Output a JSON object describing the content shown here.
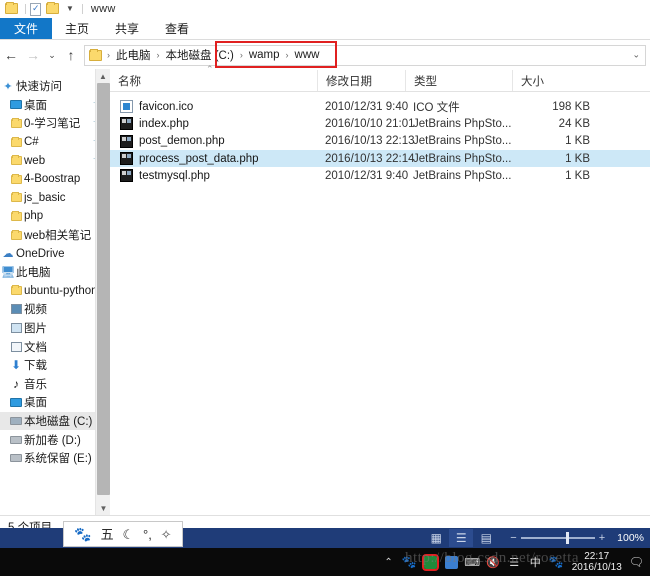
{
  "window": {
    "title": "www",
    "quick_access_icons": [
      "folder-icon",
      "properties-icon",
      "new-folder-icon",
      "customize-chevron-icon"
    ]
  },
  "ribbon": {
    "tabs": [
      {
        "label": "文件",
        "active": true
      },
      {
        "label": "主页",
        "active": false
      },
      {
        "label": "共享",
        "active": false
      },
      {
        "label": "查看",
        "active": false
      }
    ]
  },
  "addressbar": {
    "back_icon": "back-arrow-icon",
    "forward_icon": "forward-arrow-icon",
    "recent_icon": "recent-locations-icon",
    "up_icon": "up-arrow-icon",
    "dropdown_icon": "chevron-down-icon",
    "crumbs": [
      "此电脑",
      "本地磁盘 (C:)",
      "wamp",
      "www"
    ],
    "separator": "›"
  },
  "annotation": {
    "color": "#e02020",
    "shape": "rectangle"
  },
  "navpane": {
    "items": [
      {
        "label": "快速访问",
        "icon": "star-icon",
        "indent": 0,
        "pinned": false,
        "selected": false
      },
      {
        "label": "桌面",
        "icon": "desktop-icon",
        "indent": 1,
        "pinned": true,
        "selected": false
      },
      {
        "label": "0-学习笔记",
        "icon": "folder-icon",
        "indent": 1,
        "pinned": true,
        "selected": false
      },
      {
        "label": "C#",
        "icon": "folder-icon",
        "indent": 1,
        "pinned": true,
        "selected": false
      },
      {
        "label": "web",
        "icon": "folder-icon",
        "indent": 1,
        "pinned": true,
        "selected": false
      },
      {
        "label": "4-Boostrap",
        "icon": "folder-icon",
        "indent": 1,
        "pinned": false,
        "selected": false
      },
      {
        "label": "js_basic",
        "icon": "folder-icon",
        "indent": 1,
        "pinned": false,
        "selected": false
      },
      {
        "label": "php",
        "icon": "folder-icon",
        "indent": 1,
        "pinned": false,
        "selected": false
      },
      {
        "label": "web相关笔记",
        "icon": "folder-icon",
        "indent": 1,
        "pinned": false,
        "selected": false
      },
      {
        "label": "OneDrive",
        "icon": "cloud-icon",
        "indent": 0,
        "pinned": false,
        "selected": false
      },
      {
        "label": "此电脑",
        "icon": "this-pc-icon",
        "indent": 0,
        "pinned": false,
        "selected": false
      },
      {
        "label": "ubuntu-python",
        "icon": "folder-icon",
        "indent": 1,
        "pinned": false,
        "selected": false
      },
      {
        "label": "视频",
        "icon": "videos-icon",
        "indent": 1,
        "pinned": false,
        "selected": false
      },
      {
        "label": "图片",
        "icon": "pictures-icon",
        "indent": 1,
        "pinned": false,
        "selected": false
      },
      {
        "label": "文档",
        "icon": "documents-icon",
        "indent": 1,
        "pinned": false,
        "selected": false
      },
      {
        "label": "下载",
        "icon": "downloads-icon",
        "indent": 1,
        "pinned": false,
        "selected": false
      },
      {
        "label": "音乐",
        "icon": "music-icon",
        "indent": 1,
        "pinned": false,
        "selected": false
      },
      {
        "label": "桌面",
        "icon": "desktop-icon",
        "indent": 1,
        "pinned": false,
        "selected": false
      },
      {
        "label": "本地磁盘 (C:)",
        "icon": "drive-icon",
        "indent": 1,
        "pinned": false,
        "selected": true
      },
      {
        "label": "新加卷 (D:)",
        "icon": "drive-icon",
        "indent": 1,
        "pinned": false,
        "selected": false
      },
      {
        "label": "系统保留 (E:)",
        "icon": "drive-icon",
        "indent": 1,
        "pinned": false,
        "selected": false
      }
    ],
    "scrollbar": {
      "up_icon": "scroll-up-icon",
      "down_icon": "scroll-down-icon"
    }
  },
  "filelist": {
    "columns": [
      "名称",
      "修改日期",
      "类型",
      "大小"
    ],
    "sort_indicator": "ascending-caret-icon",
    "rows": [
      {
        "name": "favicon.ico",
        "date": "2010/12/31 9:40",
        "type": "ICO 文件",
        "size": "198 KB",
        "icon": "ico-file-icon",
        "selected": false
      },
      {
        "name": "index.php",
        "date": "2016/10/10 21:01",
        "type": "JetBrains PhpSto...",
        "size": "24 KB",
        "icon": "php-file-icon",
        "selected": false
      },
      {
        "name": "post_demon.php",
        "date": "2016/10/13 22:13",
        "type": "JetBrains PhpSto...",
        "size": "1 KB",
        "icon": "php-file-icon",
        "selected": false
      },
      {
        "name": "process_post_data.php",
        "date": "2016/10/13 22:14",
        "type": "JetBrains PhpSto...",
        "size": "1 KB",
        "icon": "php-file-icon",
        "selected": true
      },
      {
        "name": "testmysql.php",
        "date": "2010/12/31 9:40",
        "type": "JetBrains PhpSto...",
        "size": "1 KB",
        "icon": "php-file-icon",
        "selected": false
      }
    ]
  },
  "statusbar": {
    "item_count": "5 个项目"
  },
  "ime_bar": {
    "items": [
      {
        "icon": "baidu-paw-icon",
        "glyph": "🐾"
      },
      {
        "icon": "wubi-mode-icon",
        "glyph": "五"
      },
      {
        "icon": "moon-icon",
        "glyph": "☽"
      },
      {
        "icon": "punctuation-icon",
        "glyph": "°,"
      },
      {
        "icon": "gear-icon",
        "glyph": "✿"
      }
    ]
  },
  "viewbar": {
    "details_view_icon": "details-view-icon",
    "list_view_icon": "list-view-icon",
    "large_icons_icon": "large-icons-view-icon",
    "zoom_minus": "−",
    "zoom_plus": "+",
    "zoom_level": "100%"
  },
  "taskbar": {
    "show_hidden_icon": "chevron-up-icon",
    "tray_icons": [
      {
        "icon": "baidu-tray-icon",
        "glyph": "🐾",
        "highlighted": false
      },
      {
        "icon": "wampserver-icon",
        "glyph": "",
        "highlighted": true
      },
      {
        "icon": "app-blue-icon",
        "glyph": "",
        "highlighted": false
      },
      {
        "icon": "ime-keyboard-icon",
        "glyph": "⌨",
        "highlighted": false
      },
      {
        "icon": "volume-muted-icon",
        "glyph": "🔇",
        "highlighted": false
      },
      {
        "icon": "wifi-icon",
        "glyph": "📶",
        "highlighted": false
      },
      {
        "icon": "ime-chinese-icon",
        "glyph": "中",
        "highlighted": false
      },
      {
        "icon": "baidu-netdisk-icon",
        "glyph": "🐾",
        "highlighted": false
      }
    ],
    "clock_time": "22:17",
    "clock_date": "2016/10/13",
    "action_center_icon": "notification-icon"
  },
  "watermark": {
    "text": "http://blog.csdn.net/rosetta"
  }
}
